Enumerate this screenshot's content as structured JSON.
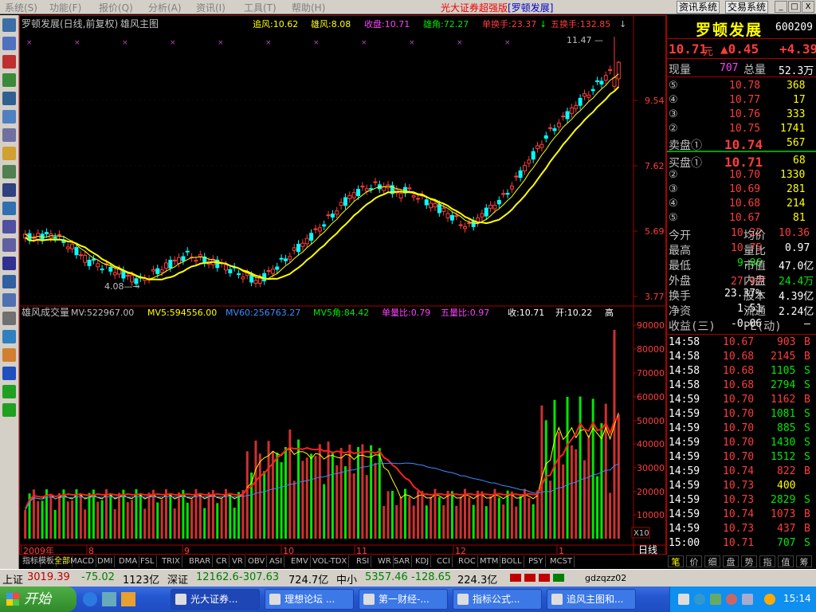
{
  "menubar": {
    "items": [
      "系统(S)",
      "功能(F)",
      "报价(Q)",
      "分析(A)",
      "资讯(I)",
      "工具(T)",
      "帮助(H)"
    ],
    "app_title": "光大证券超强版",
    "stock_tag": "[罗顿发展]",
    "btn_info": "资讯系统",
    "btn_trade": "交易系统",
    "win_buttons": [
      "_",
      "□",
      "X"
    ]
  },
  "toolbar": {
    "icons": [
      "quote-icon",
      "list-icon",
      "line-chart-icon",
      "kline-icon",
      "report-icon",
      "table-icon",
      "f10-icon",
      "news-icon",
      "people-icon",
      "finance-icon",
      "search-icon",
      "etf-icon",
      "trend-icon",
      "rsi-icon",
      "indicator-icon",
      "window-icon",
      "key-icon",
      "login-icon",
      "pencil-icon",
      "move-icon",
      "up-arrow-icon",
      "down-arrow-icon"
    ]
  },
  "chart_header": {
    "name": "罗顿发展(日线,前复权)",
    "indicator": "雄风主图",
    "items": [
      {
        "label": "追风:10.62",
        "color": "#ffff00"
      },
      {
        "label": "雄风:8.08",
        "color": "#ffff00"
      },
      {
        "label": "收盘:10.71",
        "color": "#ff40ff"
      },
      {
        "label": "雄角:72.27",
        "color": "#00e800"
      },
      {
        "label": "单换手:23.37",
        "color": "#ff3c3c"
      },
      {
        "label": "五换手:132.85",
        "color": "#ff3c3c"
      }
    ],
    "arrows": [
      "↓",
      "↓"
    ]
  },
  "vol_header": {
    "name": "雄风成交量",
    "items": [
      {
        "label": "MV:522967.00",
        "color": "#c0c0c0"
      },
      {
        "label": "MV5:594556.00",
        "color": "#ffff00"
      },
      {
        "label": "MV60:256763.27",
        "color": "#3c8cff"
      },
      {
        "label": "MV5角:84.42",
        "color": "#00e800"
      },
      {
        "label": "单量比:0.79",
        "color": "#ff40ff"
      },
      {
        "label": "五量比:0.97",
        "color": "#ff40ff"
      },
      {
        "label": "收:10.71",
        "color": "#fff"
      },
      {
        "label": "开:10.22",
        "color": "#fff"
      },
      {
        "label": "高",
        "color": "#fff"
      }
    ]
  },
  "chart_data": {
    "type": "candlestick",
    "price_axis": {
      "ticks": [
        "11.47",
        "9.54",
        "7.62",
        "5.69",
        "3.77"
      ]
    },
    "annotations": {
      "high_label": "11.47",
      "low_label": "4.08"
    },
    "volume_axis": {
      "ticks": [
        "90000",
        "80000",
        "70000",
        "60000",
        "50000",
        "40000",
        "30000",
        "20000",
        "10000"
      ],
      "unit_label": "X10"
    },
    "time_axis": {
      "labels": [
        "2009年",
        "8",
        "9",
        "10",
        "11",
        "12",
        "1"
      ],
      "period": "日线"
    }
  },
  "quote": {
    "name": "罗顿发展",
    "code": "600209",
    "price": "10.71",
    "unit": "元",
    "change": "▲0.45",
    "pct": "+4.39",
    "xianliang_label": "现量",
    "xianliang": "707",
    "zongliang_label": "总量",
    "zongliang": "52.3万",
    "sells": [
      {
        "idx": "⑤",
        "price": "10.78",
        "vol": "368"
      },
      {
        "idx": "④",
        "price": "10.77",
        "vol": "17"
      },
      {
        "idx": "③",
        "price": "10.76",
        "vol": "333"
      },
      {
        "idx": "②",
        "price": "10.75",
        "vol": "1741"
      },
      {
        "idx": "卖盘①",
        "price": "10.74",
        "vol": "567"
      }
    ],
    "buys": [
      {
        "idx": "买盘①",
        "price": "10.71",
        "vol": "68"
      },
      {
        "idx": "②",
        "price": "10.70",
        "vol": "1330"
      },
      {
        "idx": "③",
        "price": "10.69",
        "vol": "281"
      },
      {
        "idx": "④",
        "price": "10.68",
        "vol": "214"
      },
      {
        "idx": "⑤",
        "price": "10.67",
        "vol": "81"
      }
    ],
    "stats": [
      {
        "l1": "今开",
        "v1": "10.22",
        "c1": "#ff3c3c",
        "l2": "均价",
        "v2": "10.36",
        "c2": "#ff3c3c"
      },
      {
        "l1": "最高",
        "v1": "10.75",
        "c1": "#ff3c3c",
        "l2": "量比",
        "v2": "0.97",
        "c2": "#fff"
      },
      {
        "l1": "最低",
        "v1": "9.96",
        "c1": "#00e800",
        "l2": "市值",
        "v2": "47.0亿",
        "c2": "#fff"
      },
      {
        "l1": "外盘",
        "v1": "27.9万",
        "c1": "#ff3c3c",
        "l2": "内盘",
        "v2": "24.4万",
        "c2": "#00e800"
      },
      {
        "l1": "换手",
        "v1": "23.37%",
        "c1": "#fff",
        "l2": "股本",
        "v2": "4.39亿",
        "c2": "#fff"
      },
      {
        "l1": "净资",
        "v1": "1.51",
        "c1": "#fff",
        "l2": "流通",
        "v2": "2.24亿",
        "c2": "#fff"
      },
      {
        "l1": "收益(三)",
        "v1": "-0.06",
        "c1": "#fff",
        "l2": "PE(动)",
        "v2": "—",
        "c2": "#fff"
      }
    ],
    "ticks": [
      {
        "time": "14:58",
        "price": "10.67",
        "vol": "903",
        "side": "B",
        "pc": "#ff3c3c"
      },
      {
        "time": "14:58",
        "price": "10.68",
        "vol": "2145",
        "side": "B",
        "pc": "#ff3c3c"
      },
      {
        "time": "14:58",
        "price": "10.68",
        "vol": "1105",
        "side": "S",
        "pc": "#ff3c3c"
      },
      {
        "time": "14:58",
        "price": "10.68",
        "vol": "2794",
        "side": "S",
        "pc": "#ff3c3c"
      },
      {
        "time": "14:59",
        "price": "10.70",
        "vol": "1162",
        "side": "B",
        "pc": "#ff3c3c"
      },
      {
        "time": "14:59",
        "price": "10.70",
        "vol": "1081",
        "side": "S",
        "pc": "#ff3c3c"
      },
      {
        "time": "14:59",
        "price": "10.70",
        "vol": "885",
        "side": "S",
        "pc": "#ff3c3c"
      },
      {
        "time": "14:59",
        "price": "10.70",
        "vol": "1430",
        "side": "S",
        "pc": "#ff3c3c"
      },
      {
        "time": "14:59",
        "price": "10.70",
        "vol": "1512",
        "side": "S",
        "pc": "#ff3c3c"
      },
      {
        "time": "14:59",
        "price": "10.74",
        "vol": "822",
        "side": "B",
        "pc": "#ff3c3c"
      },
      {
        "time": "14:59",
        "price": "10.73",
        "vol": "400",
        "side": "",
        "pc": "#ff3c3c"
      },
      {
        "time": "14:59",
        "price": "10.73",
        "vol": "2829",
        "side": "S",
        "pc": "#ff3c3c"
      },
      {
        "time": "14:59",
        "price": "10.74",
        "vol": "1073",
        "side": "B",
        "pc": "#ff3c3c"
      },
      {
        "time": "14:59",
        "price": "10.73",
        "vol": "437",
        "side": "B",
        "pc": "#ff3c3c"
      },
      {
        "time": "15:00",
        "price": "10.71",
        "vol": "707",
        "side": "S",
        "pc": "#ff3c3c"
      }
    ]
  },
  "indicator_tabs": [
    "指标",
    "模板",
    "全部",
    "MACD",
    "DMI",
    "DMA",
    "FSL",
    "TRIX",
    "BRAR",
    "CR",
    "VR",
    "OBV",
    "ASI",
    "EMV",
    "VOL-TDX",
    "RSI",
    "WR",
    "SAR",
    "KDJ",
    "CCI",
    "ROC",
    "MTM",
    "BOLL",
    "PSY",
    "MCST"
  ],
  "side_tabs": [
    "笔",
    "价",
    "细",
    "盘",
    "势",
    "指",
    "值",
    "筹"
  ],
  "statusbar": {
    "sh_label": "上证",
    "sh_val": "3019.39",
    "sh_chg": "-75.02",
    "sh_amt": "1123亿",
    "sz_label": "深证",
    "sz_val": "12162.6",
    "sz_chg": "-307.63",
    "sz_amt": "724.7亿",
    "zx_label": "中小",
    "zx_val": "5357.46",
    "zx_chg": "-128.65",
    "zx_amt": "224.3亿",
    "user": "gdzqzz02"
  },
  "taskbar": {
    "start": "开始",
    "tasks": [
      "光大证券...",
      "理想论坛 ...",
      "第一财经-...",
      "指标公式...",
      "追风主图和..."
    ],
    "clock": "15:14"
  }
}
